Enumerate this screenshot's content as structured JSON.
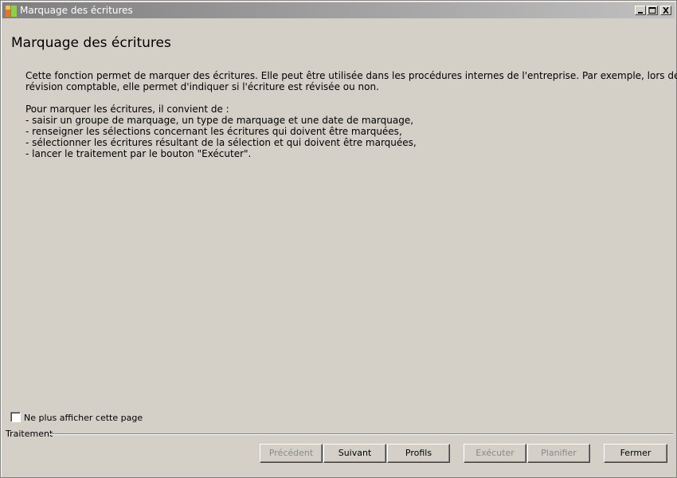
{
  "window": {
    "title": "Marquage des écritures",
    "icon": "app-icon"
  },
  "page": {
    "heading": "Marquage des écritures",
    "description_line1": "Cette fonction permet de marquer des écritures. Elle peut être utilisée dans les procédures internes de l'entreprise. Par exemple, lors de la",
    "description_line2": "révision comptable, elle permet d'indiquer si l'écriture est révisée ou non.",
    "list_intro": "Pour marquer les écritures, il convient de :",
    "steps": [
      "- saisir un groupe de marquage, un type de marquage et une date de marquage,",
      "- renseigner les sélections concernant les écritures qui doivent être marquées,",
      "- sélectionner les écritures résultant de la sélection et qui doivent être marquées,",
      "- lancer le traitement par le bouton \"Exécuter\"."
    ]
  },
  "options": {
    "hide_page_label": "Ne plus afficher cette page",
    "hide_page_checked": false
  },
  "footer": {
    "group_label": "Traitement",
    "buttons": {
      "previous": "Précédent",
      "next": "Suivant",
      "profiles": "Profils",
      "execute": "Exécuter",
      "schedule": "Planifier",
      "close": "Fermer"
    }
  },
  "colors": {
    "window_bg": "#d4d0c8",
    "title_gradient_start": "#7f7f7f",
    "disabled_text": "#8a8a8a"
  }
}
